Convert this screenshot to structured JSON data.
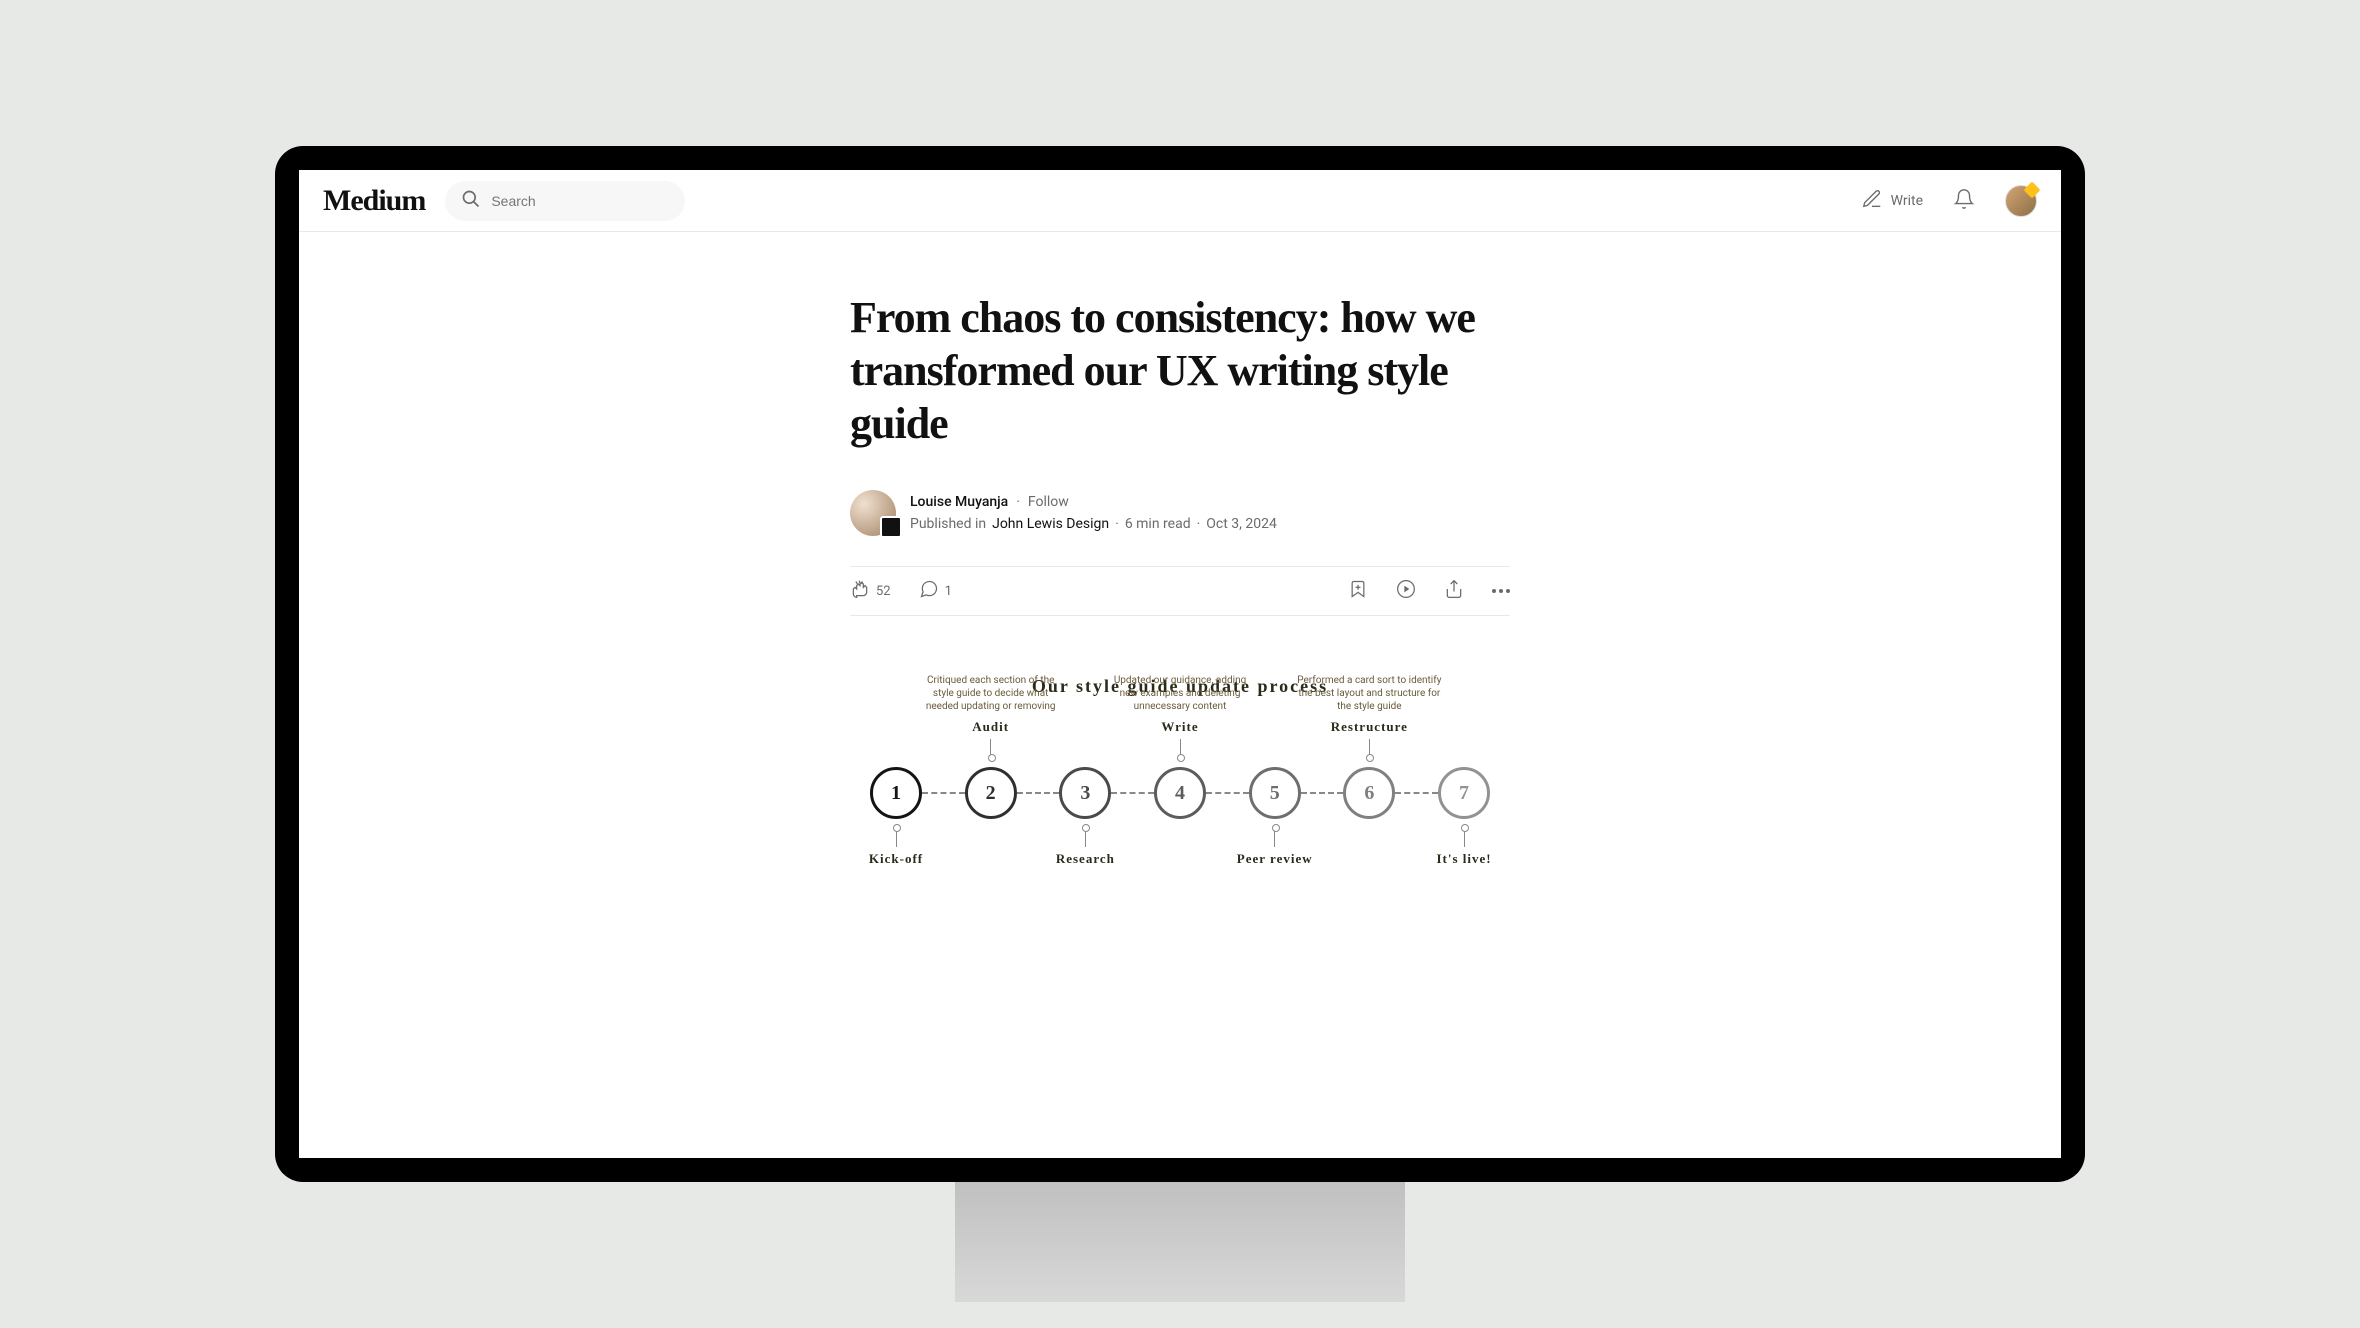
{
  "brand": "Medium",
  "search": {
    "placeholder": "Search"
  },
  "nav": {
    "write": "Write"
  },
  "article": {
    "title": "From chaos to consistency: how we transformed our UX writing style guide",
    "author": "Louise Muyanja",
    "follow": "Follow",
    "published_prefix": "Published in",
    "publication": "John Lewis Design",
    "read_time": "6 min read",
    "date": "Oct 3, 2024",
    "claps": "52",
    "responses": "1"
  },
  "diagram": {
    "title": "Our style guide update process",
    "steps": [
      {
        "n": "1",
        "opacity": 1.0
      },
      {
        "n": "2",
        "opacity": 0.85
      },
      {
        "n": "3",
        "opacity": 0.7
      },
      {
        "n": "4",
        "opacity": 0.6
      },
      {
        "n": "5",
        "opacity": 0.5
      },
      {
        "n": "6",
        "opacity": 0.4
      },
      {
        "n": "7",
        "opacity": 0.3
      }
    ],
    "upper_annotations": [
      {
        "step": 2,
        "title": "Audit",
        "desc": "Critiqued each section of the style guide to decide what needed updating or removing"
      },
      {
        "step": 4,
        "title": "Write",
        "desc": "Updated our guidance, adding new examples and deleting unnecessary content"
      },
      {
        "step": 6,
        "title": "Restructure",
        "desc": "Performed a card sort to identify the best layout and structure for the style guide"
      }
    ],
    "lower_annotations": [
      {
        "step": 1,
        "title": "Kick-off"
      },
      {
        "step": 3,
        "title": "Research"
      },
      {
        "step": 5,
        "title": "Peer review"
      },
      {
        "step": 7,
        "title": "It's live!"
      }
    ]
  }
}
